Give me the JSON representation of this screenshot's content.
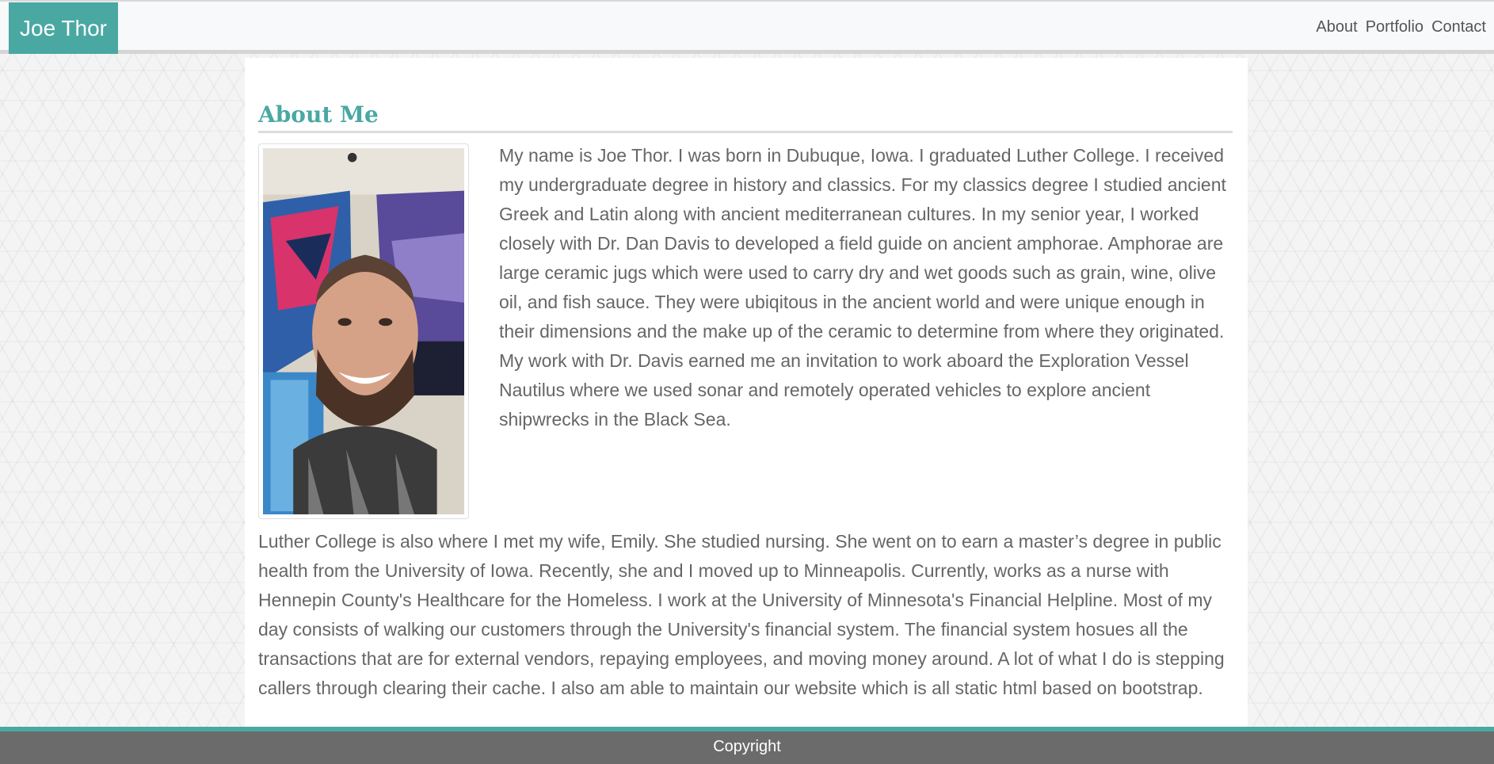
{
  "navbar": {
    "brand": "Joe Thor",
    "links": [
      "About",
      "Portfolio",
      "Contact"
    ]
  },
  "about": {
    "heading": "About Me",
    "paragraph1": "My name is Joe Thor. I was born in Dubuque, Iowa. I graduated Luther College. I received my undergraduate degree in history and classics. For my classics degree I studied ancient Greek and Latin along with ancient mediterranean cultures. In my senior year, I worked closely with Dr. Dan Davis to developed a field guide on ancient amphorae. Amphorae are large ceramic jugs which were used to carry dry and wet goods such as grain, wine, olive oil, and fish sauce. They were ubiqitous in the ancient world and were unique enough in their dimensions and the make up of the ceramic to determine from where they originated. My work with Dr. Davis earned me an invitation to work aboard the Exploration Vessel Nautilus where we used sonar and remotely operated vehicles to explore ancient shipwrecks in the Black Sea.",
    "paragraph2": "Luther College is also where I met my wife, Emily. She studied nursing. She went on to earn a master’s degree in public health from the University of Iowa. Recently, she and I moved up to Minneapolis. Currently, works as a nurse with Hennepin County's Healthcare for the Homeless. I work at the University of Minnesota's Financial Helpline. Most of my day consists of walking our customers through the University's financial system. The financial system hosues all the transactions that are for external vendors, repaying employees, and moving money around. A lot of what I do is stepping callers through clearing their cache. I also am able to maintain our website which is all static html based on bootstrap."
  },
  "footer": {
    "text": "Copyright"
  },
  "colors": {
    "accent": "#4aa8a3",
    "footer_bg": "#6b6b6b",
    "text": "#666666"
  }
}
